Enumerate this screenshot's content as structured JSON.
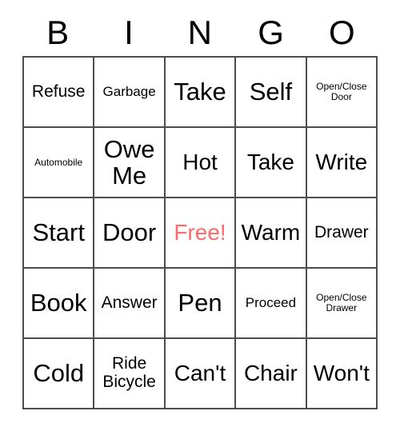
{
  "card": {
    "header": {
      "letters": [
        "B",
        "I",
        "N",
        "G",
        "O"
      ]
    },
    "rows": [
      [
        {
          "label": "Refuse",
          "size": "md",
          "free": false
        },
        {
          "label": "Garbage",
          "size": "sm",
          "free": false
        },
        {
          "label": "Take",
          "size": "xl",
          "free": false
        },
        {
          "label": "Self",
          "size": "xl",
          "free": false
        },
        {
          "label": "Open/Close Door",
          "size": "xs",
          "free": false
        }
      ],
      [
        {
          "label": "Automobile",
          "size": "xs",
          "free": false
        },
        {
          "label": "Owe Me",
          "size": "xl",
          "free": false
        },
        {
          "label": "Hot",
          "size": "lg",
          "free": false
        },
        {
          "label": "Take",
          "size": "lg",
          "free": false
        },
        {
          "label": "Write",
          "size": "lg",
          "free": false
        }
      ],
      [
        {
          "label": "Start",
          "size": "xl",
          "free": false
        },
        {
          "label": "Door",
          "size": "xl",
          "free": false
        },
        {
          "label": "Free!",
          "size": "lg",
          "free": true
        },
        {
          "label": "Warm",
          "size": "lg",
          "free": false
        },
        {
          "label": "Drawer",
          "size": "md",
          "free": false
        }
      ],
      [
        {
          "label": "Book",
          "size": "xl",
          "free": false
        },
        {
          "label": "Answer",
          "size": "md",
          "free": false
        },
        {
          "label": "Pen",
          "size": "xl",
          "free": false
        },
        {
          "label": "Proceed",
          "size": "sm",
          "free": false
        },
        {
          "label": "Open/Close Drawer",
          "size": "xs",
          "free": false
        }
      ],
      [
        {
          "label": "Cold",
          "size": "xl",
          "free": false
        },
        {
          "label": "Ride Bicycle",
          "size": "md",
          "free": false
        },
        {
          "label": "Can't",
          "size": "lg",
          "free": false
        },
        {
          "label": "Chair",
          "size": "lg",
          "free": false
        },
        {
          "label": "Won't",
          "size": "lg",
          "free": false
        }
      ]
    ],
    "colors": {
      "free_text": "#fc6a6a",
      "grid_line": "#4d4d4d",
      "text": "#000000",
      "background": "#ffffff"
    }
  }
}
